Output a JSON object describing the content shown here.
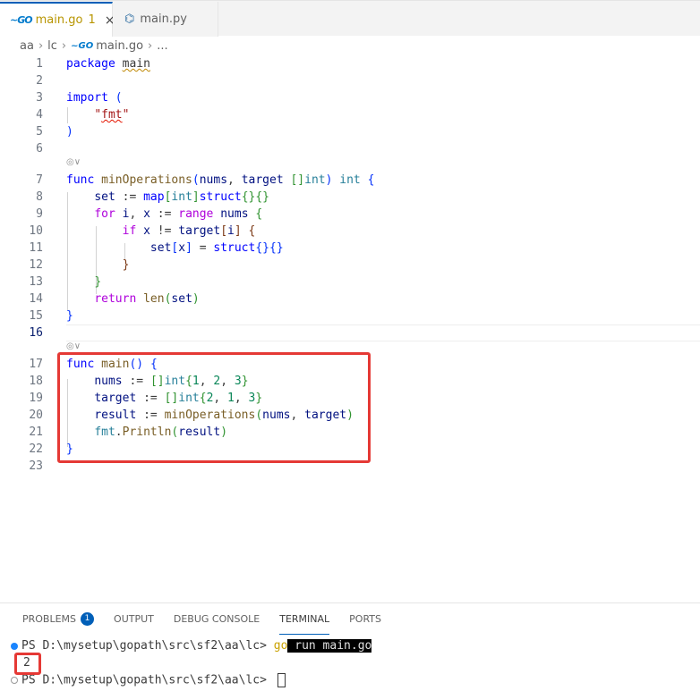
{
  "tabs": [
    {
      "icon": "go-icon",
      "label": "main.go",
      "count": "1",
      "close": "×"
    },
    {
      "icon": "python-icon",
      "label": "main.py"
    }
  ],
  "breadcrumb": [
    "aa",
    "lc",
    "main.go",
    "..."
  ],
  "editor": {
    "lines": [
      {
        "n": "1"
      },
      {
        "n": "2"
      },
      {
        "n": "3"
      },
      {
        "n": "4"
      },
      {
        "n": "5"
      },
      {
        "n": "6"
      },
      {
        "n": "7"
      },
      {
        "n": "8"
      },
      {
        "n": "9"
      },
      {
        "n": "10"
      },
      {
        "n": "11"
      },
      {
        "n": "12"
      },
      {
        "n": "13"
      },
      {
        "n": "14"
      },
      {
        "n": "15"
      },
      {
        "n": "16"
      },
      {
        "n": "17"
      },
      {
        "n": "18"
      },
      {
        "n": "19"
      },
      {
        "n": "20"
      },
      {
        "n": "21"
      },
      {
        "n": "22"
      },
      {
        "n": "23"
      }
    ],
    "current_line": "16",
    "codelens": "◎∨"
  },
  "panel": {
    "tabs": [
      "PROBLEMS",
      "OUTPUT",
      "DEBUG CONSOLE",
      "TERMINAL",
      "PORTS"
    ],
    "problems_count": "1",
    "active_tab": "TERMINAL",
    "terminal": {
      "prompt1": "PS D:\\mysetup\\gopath\\src\\sf2\\aa\\lc> ",
      "cmd_go": "go",
      "cmd_rest": " run main.go",
      "output": "2",
      "prompt2": "PS D:\\mysetup\\gopath\\src\\sf2\\aa\\lc> "
    }
  },
  "colors": {
    "accent": "#005fb8",
    "highlight": "#e53935"
  }
}
